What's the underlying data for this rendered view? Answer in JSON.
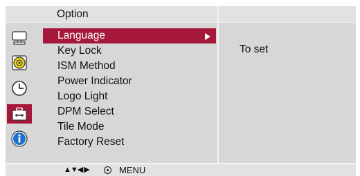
{
  "header": {
    "title": "Option"
  },
  "sidebar": {
    "icons": [
      {
        "name": "monitor-icon",
        "active": false
      },
      {
        "name": "sound-icon",
        "active": false
      },
      {
        "name": "clock-icon",
        "active": false
      },
      {
        "name": "toolbox-icon",
        "active": true
      },
      {
        "name": "info-icon",
        "active": false
      }
    ]
  },
  "menu": {
    "items": [
      {
        "label": "Language",
        "selected": true
      },
      {
        "label": "Key Lock",
        "selected": false
      },
      {
        "label": "ISM Method",
        "selected": false
      },
      {
        "label": "Power Indicator",
        "selected": false
      },
      {
        "label": "Logo Light",
        "selected": false
      },
      {
        "label": "DPM Select",
        "selected": false
      },
      {
        "label": "Tile Mode",
        "selected": false
      },
      {
        "label": "Factory Reset",
        "selected": false
      }
    ]
  },
  "description": {
    "text": "To set"
  },
  "footer": {
    "nav_glyphs": "▲▼◀ ▶",
    "menu_label": "MENU"
  },
  "colors": {
    "accent": "#a5183a",
    "panel": "#d7d7d7",
    "header": "#e2e2e2"
  }
}
